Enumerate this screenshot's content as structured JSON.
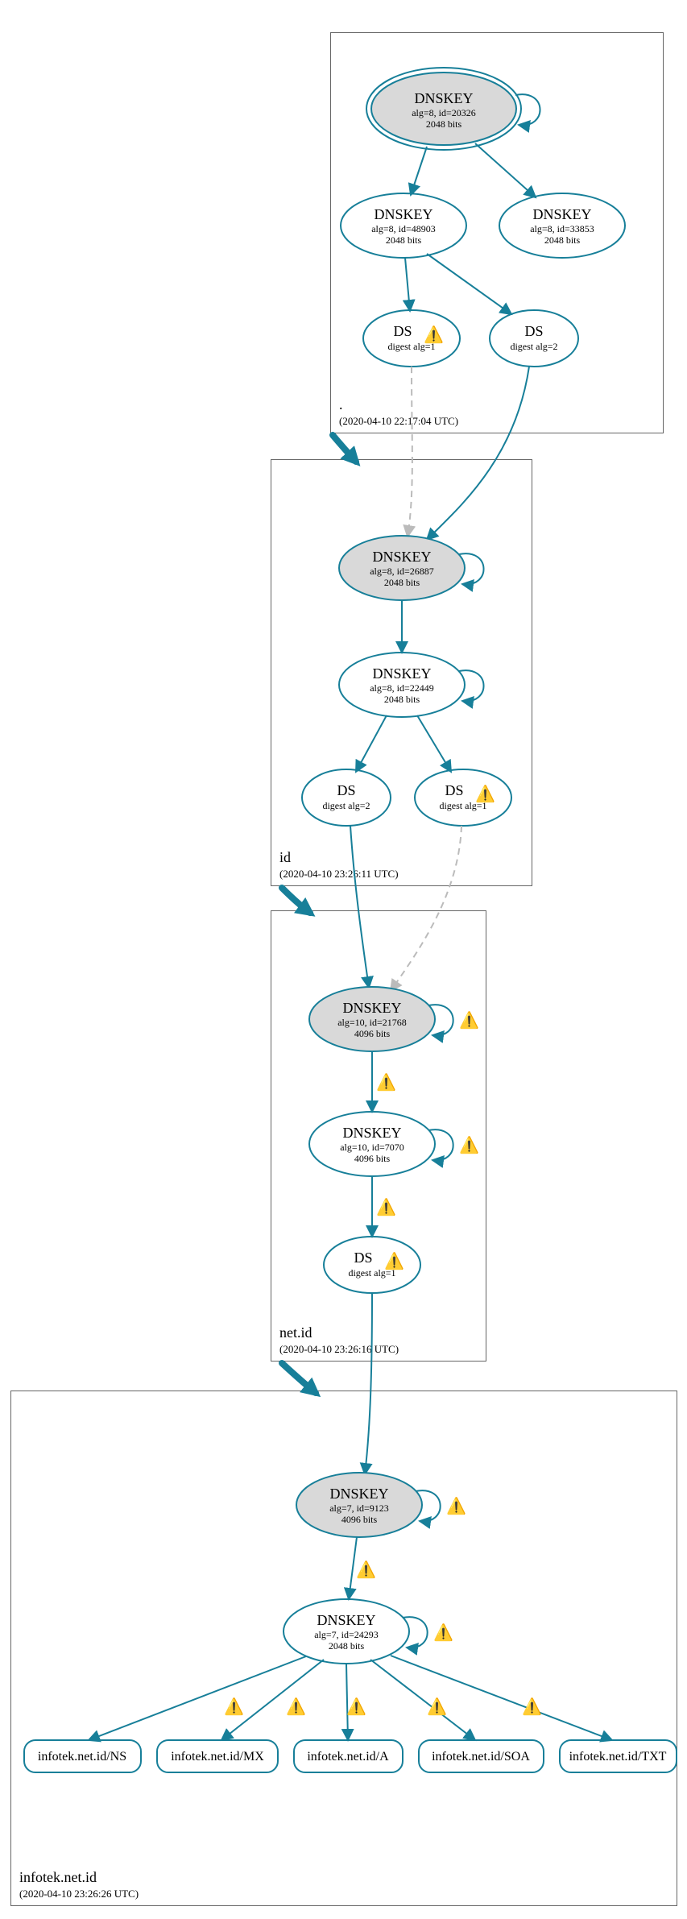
{
  "zones": {
    "root": {
      "name": ".",
      "timestamp": "(2020-04-10 22:17:04 UTC)"
    },
    "id": {
      "name": "id",
      "timestamp": "(2020-04-10 23:26:11 UTC)"
    },
    "netid": {
      "name": "net.id",
      "timestamp": "(2020-04-10 23:26:16 UTC)"
    },
    "infotek": {
      "name": "infotek.net.id",
      "timestamp": "(2020-04-10 23:26:26 UTC)"
    }
  },
  "nodes": {
    "root_ksk": {
      "l1": "DNSKEY",
      "l2": "alg=8, id=20326",
      "l3": "2048 bits"
    },
    "root_zsk1": {
      "l1": "DNSKEY",
      "l2": "alg=8, id=48903",
      "l3": "2048 bits"
    },
    "root_zsk2": {
      "l1": "DNSKEY",
      "l2": "alg=8, id=33853",
      "l3": "2048 bits"
    },
    "root_ds1": {
      "l1": "DS",
      "l2": "digest alg=1"
    },
    "root_ds2": {
      "l1": "DS",
      "l2": "digest alg=2"
    },
    "id_ksk": {
      "l1": "DNSKEY",
      "l2": "alg=8, id=26887",
      "l3": "2048 bits"
    },
    "id_zsk": {
      "l1": "DNSKEY",
      "l2": "alg=8, id=22449",
      "l3": "2048 bits"
    },
    "id_ds2": {
      "l1": "DS",
      "l2": "digest alg=2"
    },
    "id_ds1": {
      "l1": "DS",
      "l2": "digest alg=1"
    },
    "netid_ksk": {
      "l1": "DNSKEY",
      "l2": "alg=10, id=21768",
      "l3": "4096 bits"
    },
    "netid_zsk": {
      "l1": "DNSKEY",
      "l2": "alg=10, id=7070",
      "l3": "4096 bits"
    },
    "netid_ds1": {
      "l1": "DS",
      "l2": "digest alg=1"
    },
    "inf_ksk": {
      "l1": "DNSKEY",
      "l2": "alg=7, id=9123",
      "l3": "4096 bits"
    },
    "inf_zsk": {
      "l1": "DNSKEY",
      "l2": "alg=7, id=24293",
      "l3": "2048 bits"
    }
  },
  "leaves": {
    "ns": "infotek.net.id/NS",
    "mx": "infotek.net.id/MX",
    "a": "infotek.net.id/A",
    "soa": "infotek.net.id/SOA",
    "txt": "infotek.net.id/TXT"
  },
  "warn_glyph": "⚠️"
}
